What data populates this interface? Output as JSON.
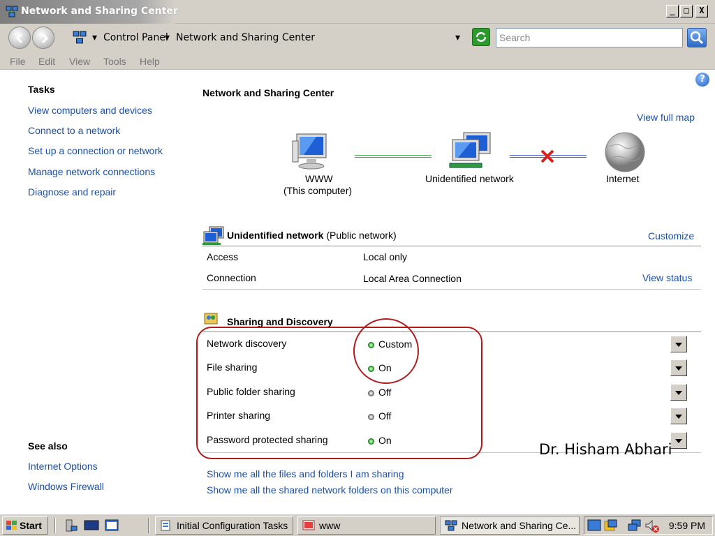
{
  "window": {
    "title": "Network and Sharing Center",
    "min_label": "_",
    "max_label": "□",
    "close_label": "X"
  },
  "address": {
    "seg1": "Control Panel",
    "seg2": "Network and Sharing Center",
    "search_placeholder": "Search"
  },
  "menu": [
    "File",
    "Edit",
    "View",
    "Tools",
    "Help"
  ],
  "tasks": {
    "title": "Tasks",
    "items": [
      "View computers and devices",
      "Connect to a network",
      "Set up a connection or network",
      "Manage network connections",
      "Diagnose and repair"
    ]
  },
  "see_also": {
    "title": "See also",
    "items": [
      "Internet Options",
      "Windows Firewall"
    ]
  },
  "main": {
    "title": "Network and Sharing Center",
    "view_full_map": "View full map",
    "map": {
      "computer_name": "WWW",
      "computer_sub": "(This computer)",
      "network": "Unidentified network",
      "internet": "Internet"
    },
    "network": {
      "name": "Unidentified network",
      "type": "(Public network)",
      "customize": "Customize",
      "rows": [
        {
          "label": "Access",
          "value": "Local only",
          "link": ""
        },
        {
          "label": "Connection",
          "value": "Local Area Connection",
          "link": "View status"
        }
      ]
    },
    "sharing": {
      "title": "Sharing and Discovery",
      "rows": [
        {
          "label": "Network discovery",
          "value": "Custom",
          "state": "on"
        },
        {
          "label": "File sharing",
          "value": "On",
          "state": "on"
        },
        {
          "label": "Public folder sharing",
          "value": "Off",
          "state": "off"
        },
        {
          "label": "Printer sharing",
          "value": "Off",
          "state": "off"
        },
        {
          "label": "Password protected sharing",
          "value": "On",
          "state": "on"
        }
      ]
    },
    "bottom_links": [
      "Show me all the files and folders I am sharing",
      "Show me all the shared network folders on this computer"
    ],
    "watermark": "Dr. Hisham Abhari"
  },
  "taskbar": {
    "start": "Start",
    "tasks": [
      {
        "label": "Initial Configuration Tasks"
      },
      {
        "label": "www"
      },
      {
        "label": "Network and Sharing Ce..."
      }
    ],
    "clock": "9:59 PM"
  },
  "colors": {
    "link": "#1c4fa8",
    "annotation_red": "#b01c1c",
    "status_on": "#2fa82f",
    "status_off": "#8a8a8a"
  }
}
